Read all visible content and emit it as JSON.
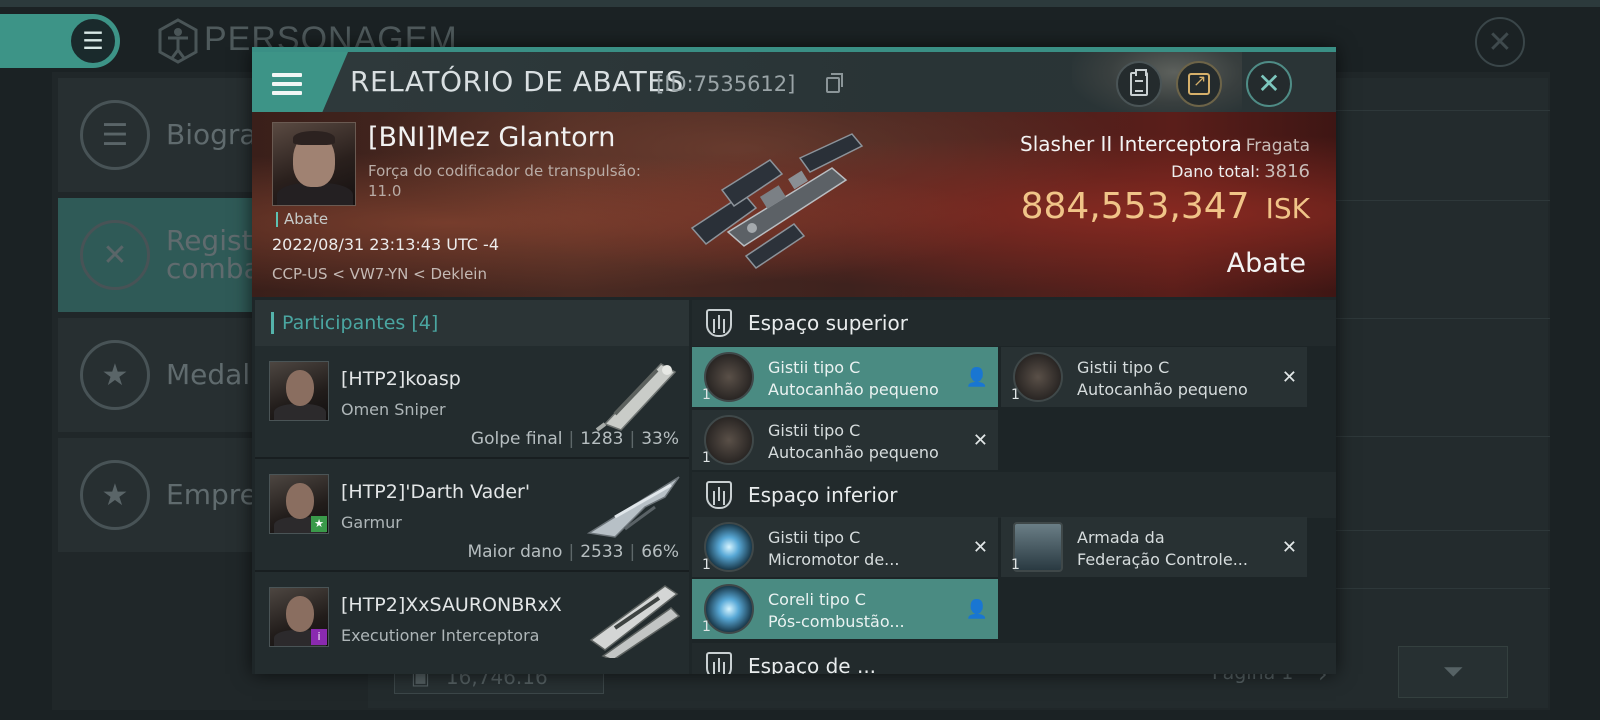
{
  "background": {
    "menu_icon": "hamburger-icon",
    "title_icon": "character-icon",
    "title": "PERSONAGEM",
    "sidebar": [
      {
        "label": "Biogra",
        "icon": "list-icon",
        "active": false
      },
      {
        "label": "Registr combat",
        "icon": "crossed-swords-icon",
        "active": true
      },
      {
        "label": "Medalh",
        "icon": "star-badge-icon",
        "active": false
      },
      {
        "label": "Empre",
        "icon": "star-circle-icon",
        "active": false
      }
    ],
    "footer_value": "16,746.16",
    "page_label": "Página 1",
    "colors": {
      "accent": "#3d9487",
      "background": "#1b2224"
    }
  },
  "dialog": {
    "title": "RELATÓRIO DE ABATES",
    "id": "[ID:7535612]",
    "victim": {
      "name": "[BNI]Mez Glantorn",
      "sub": "Força do codificador de transpulsão: 11.0",
      "tag": "Abate",
      "date": "2022/08/31 23:13:43 UTC -4",
      "location": "CCP-US < VW7-YN < Deklein"
    },
    "ship": {
      "name": "Slasher II Interceptora",
      "class": "Fragata",
      "damage_label": "Dano total:",
      "damage": "3816",
      "isk_value": "884,553,347",
      "isk_unit": "ISK",
      "kill_type": "Abate"
    },
    "participants": {
      "title": "Participantes [4]",
      "rows": [
        {
          "name": "[HTP2]koasp",
          "ship": "Omen Sniper",
          "role": "Golpe final",
          "damage": "1283",
          "percent": "33%",
          "badge": ""
        },
        {
          "name": "[HTP2]'Darth Vader'",
          "ship": "Garmur",
          "role": "Maior dano",
          "damage": "2533",
          "percent": "66%",
          "badge": "star"
        },
        {
          "name": "[HTP2]XxSAURONBRxX",
          "ship": "Executioner Interceptora",
          "role": "",
          "damage": "",
          "percent": "",
          "badge": "info"
        }
      ]
    },
    "fitting": {
      "high_slot": "Espaço superior",
      "low_slot": "Espaço inferior",
      "cut_slot": "Espaço de ...",
      "high_modules": [
        {
          "line1": "Gistii tipo C",
          "line2": "Autocanhão pequeno",
          "qty": "1",
          "state": "dropped"
        },
        {
          "line1": "Gistii tipo C",
          "line2": "Autocanhão pequeno",
          "qty": "1",
          "state": "destroyed"
        },
        {
          "line1": "Gistii tipo C",
          "line2": "Autocanhão pequeno",
          "qty": "1",
          "state": "destroyed"
        }
      ],
      "low_modules": [
        {
          "line1": "Gistii tipo C",
          "line2": "Micromotor de...",
          "qty": "1",
          "state": "destroyed"
        },
        {
          "line1": "Armada da",
          "line2": "Federação Controle...",
          "qty": "1",
          "state": "destroyed"
        },
        {
          "line1": "Coreli tipo C",
          "line2": "Pós-combustão...",
          "qty": "1",
          "state": "dropped"
        }
      ]
    }
  }
}
